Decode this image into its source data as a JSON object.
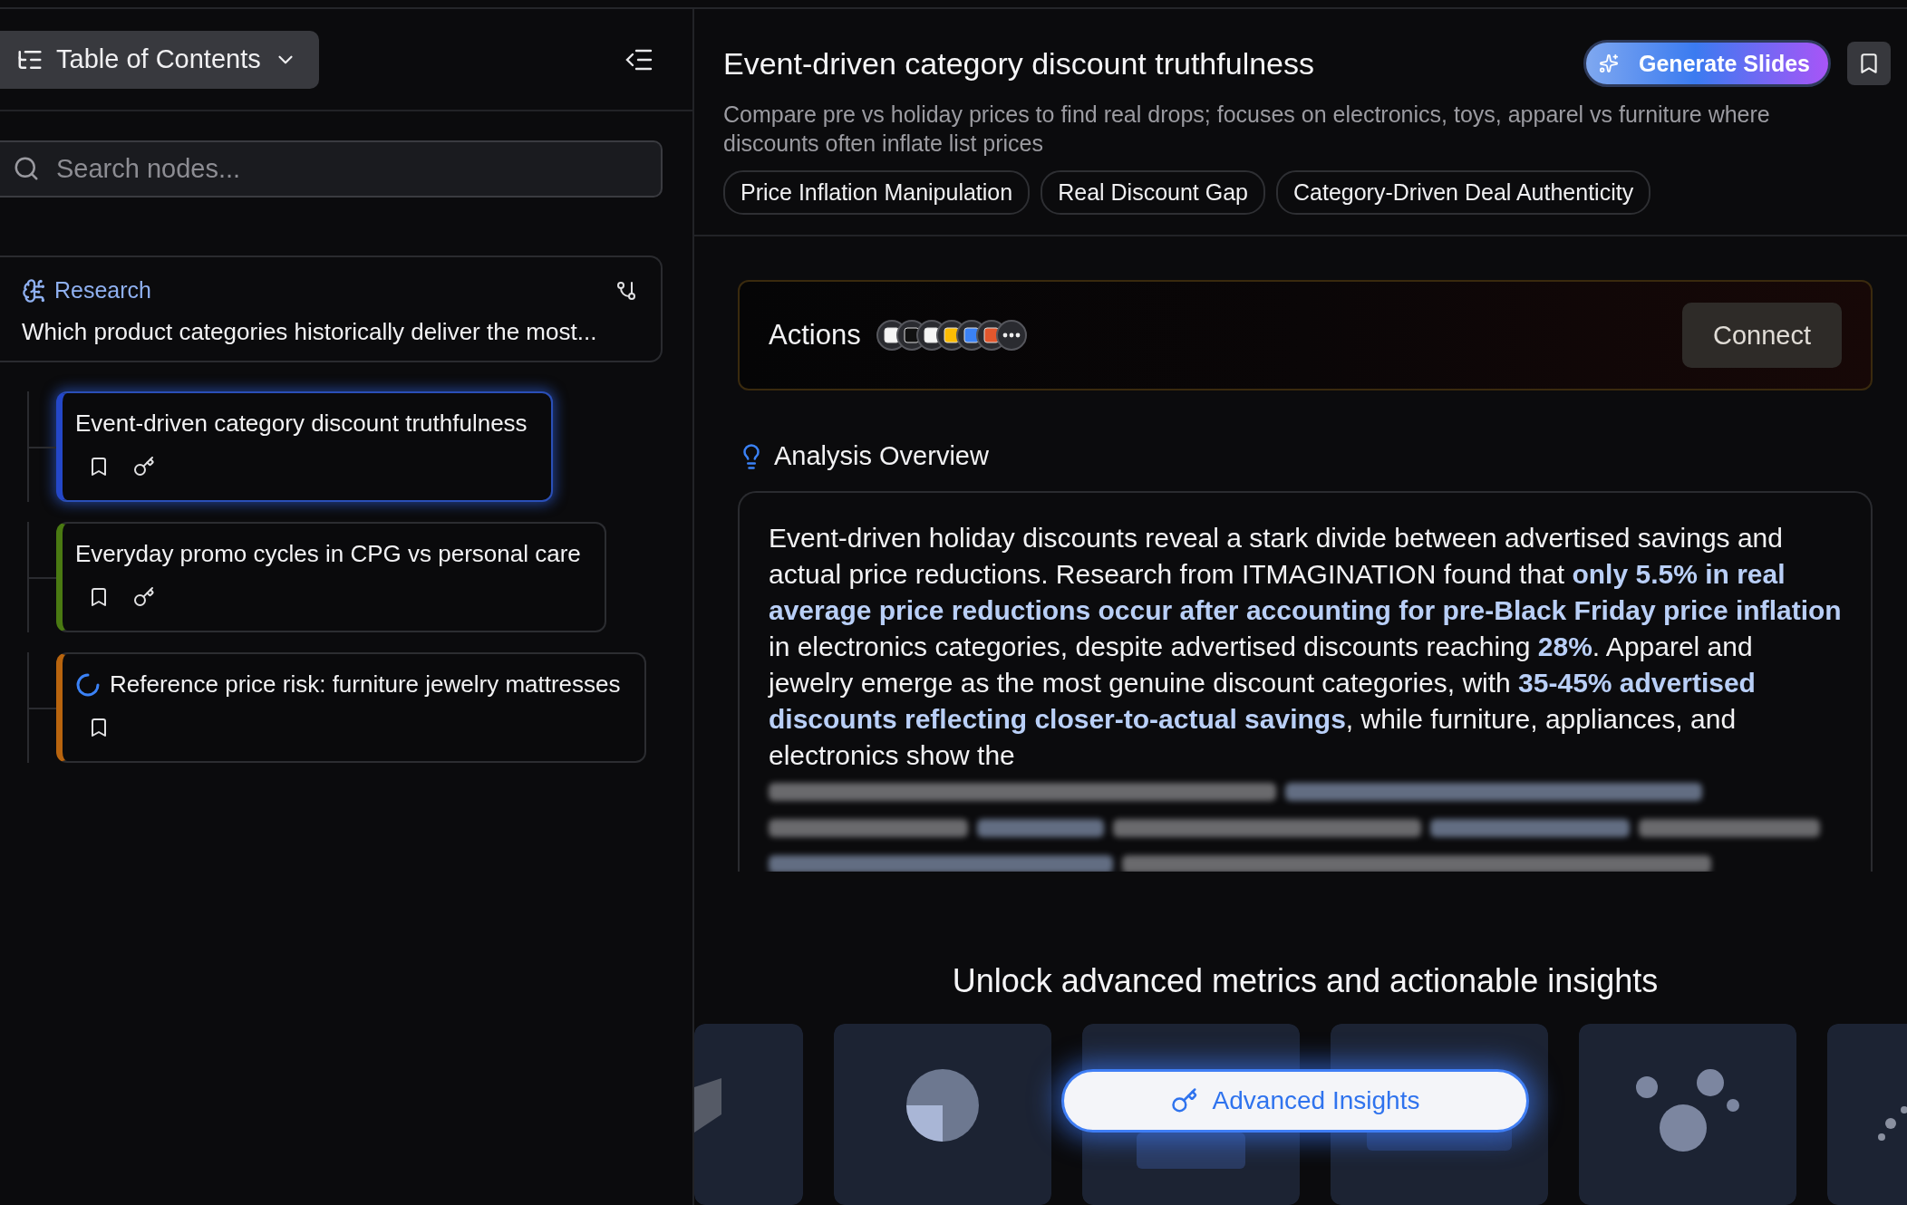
{
  "sidebar": {
    "toc_button": {
      "label": "Table of Contents"
    },
    "search": {
      "placeholder": "Search nodes..."
    },
    "root": {
      "label": "Research",
      "question": "Which product categories historically deliver the most..."
    },
    "nodes": [
      {
        "title": "Event-driven category discount truthfulness",
        "selected": true,
        "color": "#2447c8",
        "loading": false,
        "bookmark": true,
        "key": true
      },
      {
        "title": "Everyday promo cycles in CPG vs personal care",
        "selected": false,
        "color": "#4a7a12",
        "loading": false,
        "bookmark": true,
        "key": true
      },
      {
        "title": "Reference price risk: furniture jewelry mattresses",
        "selected": false,
        "color": "#b8640e",
        "loading": true,
        "bookmark": true,
        "key": false
      }
    ]
  },
  "header": {
    "title": "Event-driven category discount truthfulness",
    "generate_button": "Generate Slides",
    "description": "Compare pre vs holiday prices to find real drops; focuses on electronics, toys, apparel vs furniture where discounts often inflate list prices",
    "tags": [
      "Price Inflation Manipulation",
      "Real Discount Gap",
      "Category-Driven Deal Authenticity"
    ]
  },
  "actions": {
    "label": "Actions",
    "connect_button": "Connect"
  },
  "analysis": {
    "heading": "Analysis Overview",
    "text": "Event-driven holiday discounts reveal a stark divide between advertised savings and actual price reductions. Research from ITMAGINATION found that **only 5.5% in real average price reductions occur after accounting for pre-Black Friday price inflation** in electronics categories, despite advertised discounts reaching **28%**. Apparel and jewelry emerge as the most genuine discount categories, with **35-45% advertised discounts reflecting closer-to-actual savings**, while furniture, appliances, and electronics show the"
  },
  "upsell": {
    "heading": "Unlock advanced metrics and actionable insights",
    "button": "Advanced Insights"
  }
}
